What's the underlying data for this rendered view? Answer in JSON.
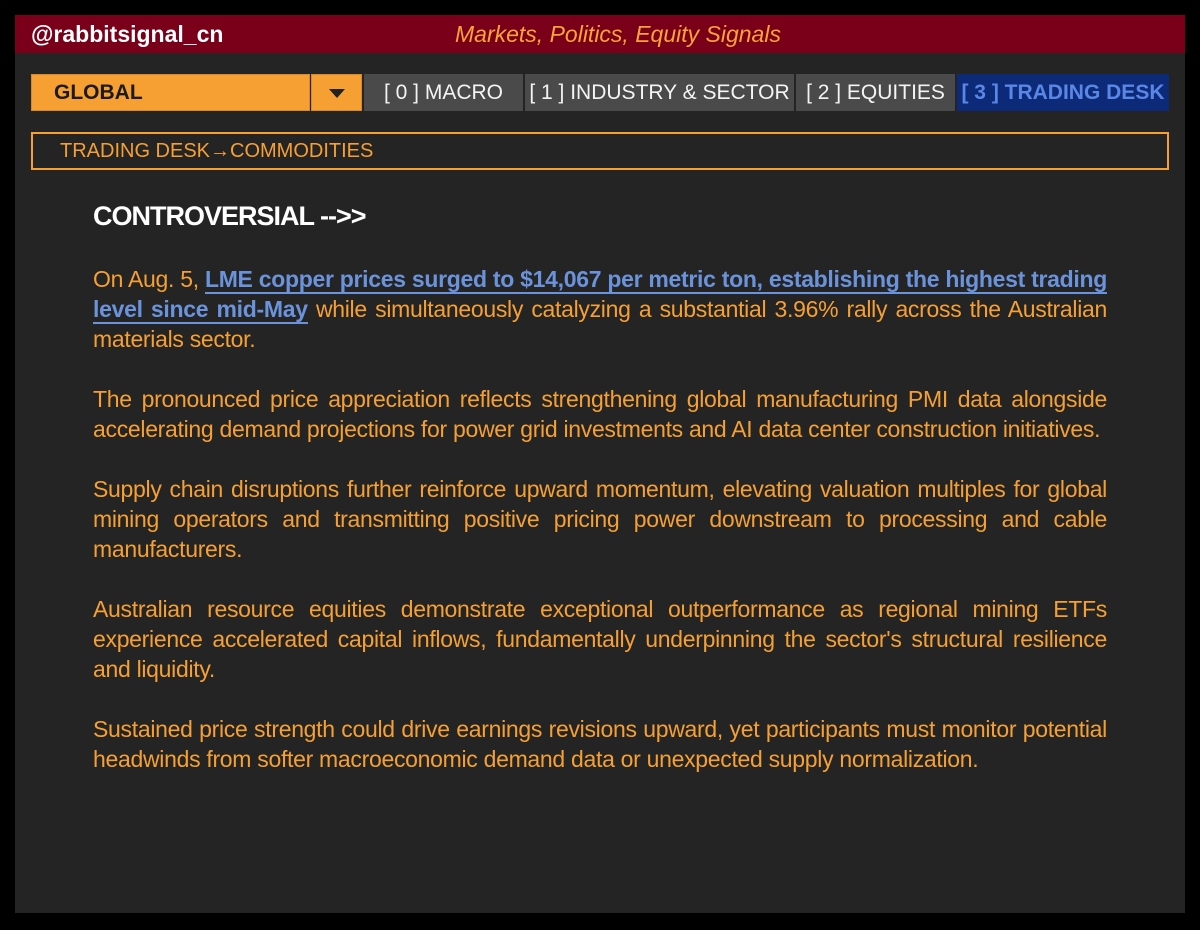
{
  "header": {
    "handle": "@rabbitsignal_cn",
    "tagline": "Markets, Politics, Equity Signals"
  },
  "region_selector": {
    "selected": "GLOBAL"
  },
  "tabs": [
    {
      "label": "[ 0 ] MACRO",
      "active": false
    },
    {
      "label": "[ 1 ] INDUSTRY & SECTOR",
      "active": false
    },
    {
      "label": "[ 2 ] EQUITIES",
      "active": false
    },
    {
      "label": "[ 3 ] TRADING DESK",
      "active": true
    }
  ],
  "breadcrumb": "TRADING DESK→COMMODITIES",
  "article": {
    "heading": "CONTROVERSIAL -->>",
    "p1_lead": "On Aug. 5, ",
    "p1_link": "LME copper prices surged to $14,067 per metric ton, establishing the highest trading level since mid-May",
    "p1_rest": " while simultaneously catalyzing a substantial 3.96% rally across the Australian materials sector.",
    "paragraphs": [
      "The pronounced price appreciation reflects strengthening global manufacturing PMI data alongside accelerating demand projections for power grid investments and AI data center construction initiatives.",
      "Supply chain disruptions further reinforce upward momentum, elevating valuation multiples for global mining operators and transmitting positive pricing power downstream to processing and cable manufacturers.",
      "Australian resource equities demonstrate exceptional outperformance as regional mining ETFs experience accelerated capital inflows, fundamentally underpinning the sector's structural resilience and liquidity.",
      "Sustained price strength could drive earnings revisions upward, yet participants must monitor potential headwinds from softer macroeconomic demand data or unexpected supply normalization."
    ]
  },
  "colors": {
    "header_bg": "#7a0019",
    "accent": "#f6a033",
    "active_tab_bg": "#0c2a78",
    "link": "#6b93dc",
    "panel_bg": "#242424"
  },
  "icons": {
    "dropdown": "chevron-down-icon"
  }
}
